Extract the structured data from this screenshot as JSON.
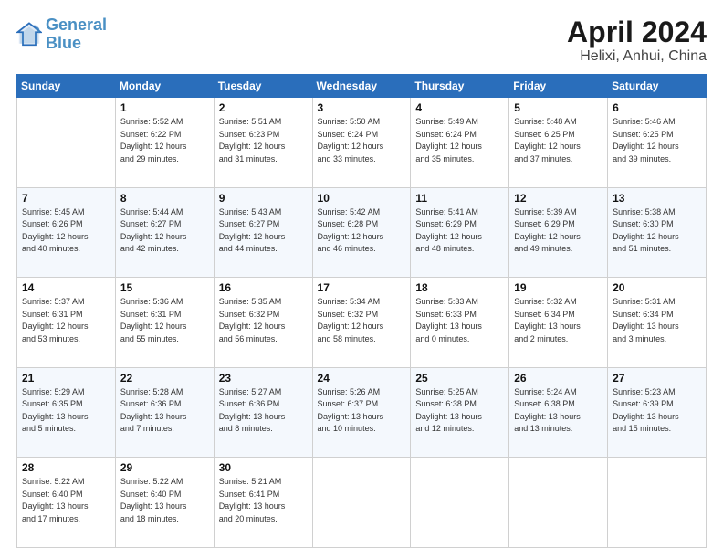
{
  "header": {
    "logo_line1": "General",
    "logo_line2": "Blue",
    "title": "April 2024",
    "subtitle": "Helixi, Anhui, China"
  },
  "weekdays": [
    "Sunday",
    "Monday",
    "Tuesday",
    "Wednesday",
    "Thursday",
    "Friday",
    "Saturday"
  ],
  "rows": [
    [
      {
        "day": "",
        "detail": ""
      },
      {
        "day": "1",
        "detail": "Sunrise: 5:52 AM\nSunset: 6:22 PM\nDaylight: 12 hours\nand 29 minutes."
      },
      {
        "day": "2",
        "detail": "Sunrise: 5:51 AM\nSunset: 6:23 PM\nDaylight: 12 hours\nand 31 minutes."
      },
      {
        "day": "3",
        "detail": "Sunrise: 5:50 AM\nSunset: 6:24 PM\nDaylight: 12 hours\nand 33 minutes."
      },
      {
        "day": "4",
        "detail": "Sunrise: 5:49 AM\nSunset: 6:24 PM\nDaylight: 12 hours\nand 35 minutes."
      },
      {
        "day": "5",
        "detail": "Sunrise: 5:48 AM\nSunset: 6:25 PM\nDaylight: 12 hours\nand 37 minutes."
      },
      {
        "day": "6",
        "detail": "Sunrise: 5:46 AM\nSunset: 6:25 PM\nDaylight: 12 hours\nand 39 minutes."
      }
    ],
    [
      {
        "day": "7",
        "detail": "Sunrise: 5:45 AM\nSunset: 6:26 PM\nDaylight: 12 hours\nand 40 minutes."
      },
      {
        "day": "8",
        "detail": "Sunrise: 5:44 AM\nSunset: 6:27 PM\nDaylight: 12 hours\nand 42 minutes."
      },
      {
        "day": "9",
        "detail": "Sunrise: 5:43 AM\nSunset: 6:27 PM\nDaylight: 12 hours\nand 44 minutes."
      },
      {
        "day": "10",
        "detail": "Sunrise: 5:42 AM\nSunset: 6:28 PM\nDaylight: 12 hours\nand 46 minutes."
      },
      {
        "day": "11",
        "detail": "Sunrise: 5:41 AM\nSunset: 6:29 PM\nDaylight: 12 hours\nand 48 minutes."
      },
      {
        "day": "12",
        "detail": "Sunrise: 5:39 AM\nSunset: 6:29 PM\nDaylight: 12 hours\nand 49 minutes."
      },
      {
        "day": "13",
        "detail": "Sunrise: 5:38 AM\nSunset: 6:30 PM\nDaylight: 12 hours\nand 51 minutes."
      }
    ],
    [
      {
        "day": "14",
        "detail": "Sunrise: 5:37 AM\nSunset: 6:31 PM\nDaylight: 12 hours\nand 53 minutes."
      },
      {
        "day": "15",
        "detail": "Sunrise: 5:36 AM\nSunset: 6:31 PM\nDaylight: 12 hours\nand 55 minutes."
      },
      {
        "day": "16",
        "detail": "Sunrise: 5:35 AM\nSunset: 6:32 PM\nDaylight: 12 hours\nand 56 minutes."
      },
      {
        "day": "17",
        "detail": "Sunrise: 5:34 AM\nSunset: 6:32 PM\nDaylight: 12 hours\nand 58 minutes."
      },
      {
        "day": "18",
        "detail": "Sunrise: 5:33 AM\nSunset: 6:33 PM\nDaylight: 13 hours\nand 0 minutes."
      },
      {
        "day": "19",
        "detail": "Sunrise: 5:32 AM\nSunset: 6:34 PM\nDaylight: 13 hours\nand 2 minutes."
      },
      {
        "day": "20",
        "detail": "Sunrise: 5:31 AM\nSunset: 6:34 PM\nDaylight: 13 hours\nand 3 minutes."
      }
    ],
    [
      {
        "day": "21",
        "detail": "Sunrise: 5:29 AM\nSunset: 6:35 PM\nDaylight: 13 hours\nand 5 minutes."
      },
      {
        "day": "22",
        "detail": "Sunrise: 5:28 AM\nSunset: 6:36 PM\nDaylight: 13 hours\nand 7 minutes."
      },
      {
        "day": "23",
        "detail": "Sunrise: 5:27 AM\nSunset: 6:36 PM\nDaylight: 13 hours\nand 8 minutes."
      },
      {
        "day": "24",
        "detail": "Sunrise: 5:26 AM\nSunset: 6:37 PM\nDaylight: 13 hours\nand 10 minutes."
      },
      {
        "day": "25",
        "detail": "Sunrise: 5:25 AM\nSunset: 6:38 PM\nDaylight: 13 hours\nand 12 minutes."
      },
      {
        "day": "26",
        "detail": "Sunrise: 5:24 AM\nSunset: 6:38 PM\nDaylight: 13 hours\nand 13 minutes."
      },
      {
        "day": "27",
        "detail": "Sunrise: 5:23 AM\nSunset: 6:39 PM\nDaylight: 13 hours\nand 15 minutes."
      }
    ],
    [
      {
        "day": "28",
        "detail": "Sunrise: 5:22 AM\nSunset: 6:40 PM\nDaylight: 13 hours\nand 17 minutes."
      },
      {
        "day": "29",
        "detail": "Sunrise: 5:22 AM\nSunset: 6:40 PM\nDaylight: 13 hours\nand 18 minutes."
      },
      {
        "day": "30",
        "detail": "Sunrise: 5:21 AM\nSunset: 6:41 PM\nDaylight: 13 hours\nand 20 minutes."
      },
      {
        "day": "",
        "detail": ""
      },
      {
        "day": "",
        "detail": ""
      },
      {
        "day": "",
        "detail": ""
      },
      {
        "day": "",
        "detail": ""
      }
    ]
  ]
}
